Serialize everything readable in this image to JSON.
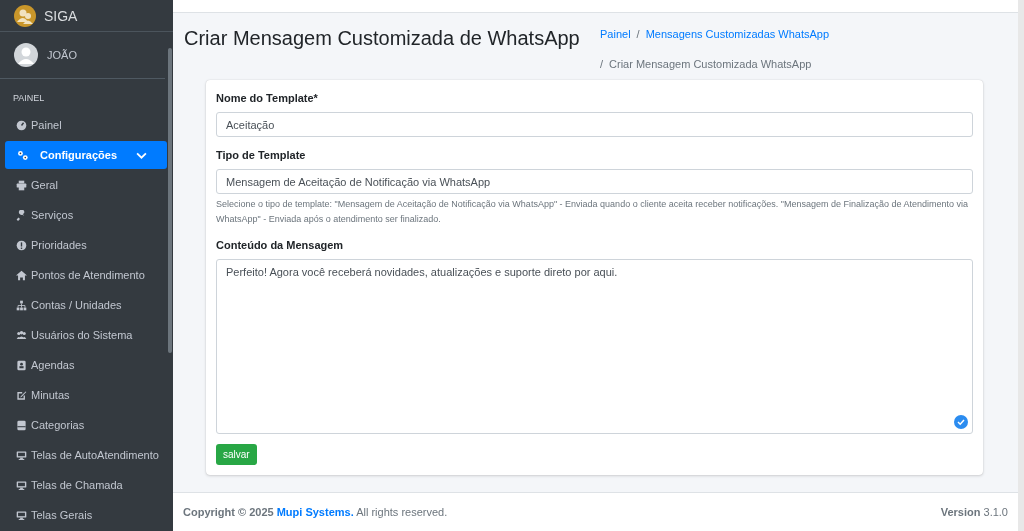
{
  "brand": {
    "name": "SIGA"
  },
  "user": {
    "name": "JOÃO"
  },
  "sidebar": {
    "items": [
      {
        "kind": "header",
        "label": "PAINEL",
        "selected": false
      },
      {
        "kind": "link",
        "label": "Painel",
        "selected": false
      },
      {
        "kind": "group",
        "label": "Configurações",
        "selected": true,
        "expanded": true
      },
      {
        "kind": "link",
        "label": "Geral",
        "selected": false
      },
      {
        "kind": "link",
        "label": "Serviços",
        "selected": false
      },
      {
        "kind": "link",
        "label": "Prioridades",
        "selected": false
      },
      {
        "kind": "link",
        "label": "Pontos de Atendimento",
        "selected": false
      },
      {
        "kind": "link",
        "label": "Contas / Unidades",
        "selected": false
      },
      {
        "kind": "link",
        "label": "Usuários do Sistema",
        "selected": false
      },
      {
        "kind": "link",
        "label": "Agendas",
        "selected": false
      },
      {
        "kind": "link",
        "label": "Minutas",
        "selected": false
      },
      {
        "kind": "link",
        "label": "Categorias",
        "selected": false
      },
      {
        "kind": "link",
        "label": "Telas de AutoAtendimento",
        "selected": false
      },
      {
        "kind": "link",
        "label": "Telas de Chamada",
        "selected": false
      },
      {
        "kind": "link",
        "label": "Telas Gerais",
        "selected": false
      }
    ]
  },
  "page": {
    "title": "Criar Mensagem Customizada de WhatsApp",
    "breadcrumbs": [
      {
        "label": "Painel",
        "link": true
      },
      {
        "separator": "/",
        "label": "Mensagens Customizadas WhatsApp",
        "link": true
      },
      {
        "separator": "/",
        "label": "Criar Mensagem Customizada WhatsApp",
        "link": false
      }
    ]
  },
  "form": {
    "fields": [
      {
        "kind": "input",
        "label": "Nome do Template*",
        "value": "Aceitação"
      },
      {
        "kind": "select",
        "label": "Tipo de Template",
        "value": "Mensagem de Aceitação de Notificação via WhatsApp",
        "help": "Selecione o tipo de template: \"Mensagem de Aceitação de Notificação via WhatsApp\" - Enviada quando o cliente aceita receber notificações. \"Mensagem de Finalização de Atendimento via WhatsApp\" - Enviada após o atendimento ser finalizado."
      },
      {
        "kind": "textarea",
        "label": "Conteúdo da Mensagem",
        "value": "Perfeito! Agora você receberá novidades, atualizações e suporte direto por aqui."
      }
    ],
    "submit": "salvar"
  },
  "footer": {
    "copyright": "Copyright © 2025",
    "company": "Mupi Systems.",
    "rights": "All rights reserved.",
    "version": "**Version** 3.1.0"
  }
}
